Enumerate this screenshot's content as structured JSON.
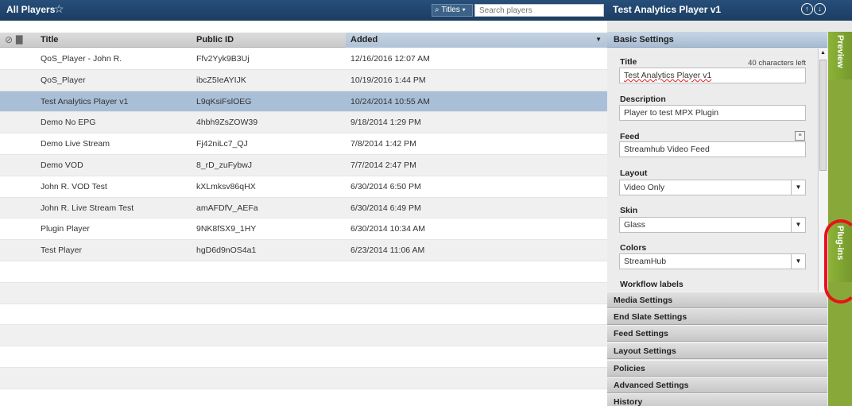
{
  "list": {
    "title": "All Players",
    "search": {
      "filter_label": "Titles",
      "placeholder": "Search players"
    },
    "columns": {
      "title": "Title",
      "public_id": "Public ID",
      "added": "Added"
    },
    "rows": [
      {
        "title": "QoS_Player - John R.",
        "public_id": "Ffv2Yyk9B3Uj",
        "added": "12/16/2016 12:07 AM"
      },
      {
        "title": "QoS_Player",
        "public_id": "ibcZ5IeAYIJK",
        "added": "10/19/2016 1:44 PM"
      },
      {
        "title": "Test Analytics Player v1",
        "public_id": "L9qKsiFslOEG",
        "added": "10/24/2014 10:55 AM"
      },
      {
        "title": "Demo No EPG",
        "public_id": "4hbh9ZsZOW39",
        "added": "9/18/2014 1:29 PM"
      },
      {
        "title": "Demo Live Stream",
        "public_id": "Fj42niLc7_QJ",
        "added": "7/8/2014 1:42 PM"
      },
      {
        "title": "Demo VOD",
        "public_id": "8_rD_zuFybwJ",
        "added": "7/7/2014 2:47 PM"
      },
      {
        "title": "John R. VOD Test",
        "public_id": "kXLmksv86qHX",
        "added": "6/30/2014 6:50 PM"
      },
      {
        "title": "John R. Live Stream Test",
        "public_id": "amAFDfV_AEFa",
        "added": "6/30/2014 6:49 PM"
      },
      {
        "title": "Plugin Player",
        "public_id": "9NK8fSX9_1HY",
        "added": "6/30/2014 10:34 AM"
      },
      {
        "title": "Test Player",
        "public_id": "hgD6d9nOS4a1",
        "added": "6/23/2014 11:06 AM"
      }
    ],
    "selected_index": 2
  },
  "detail": {
    "title": "Test Analytics Player v1",
    "basic_settings": {
      "header": "Basic Settings",
      "title_label": "Title",
      "chars_left": "40 characters left",
      "title_value": "Test Analytics Player v1",
      "description_label": "Description",
      "description_value": "Player to test MPX Plugin",
      "feed_label": "Feed",
      "feed_value": "Streamhub Video Feed",
      "layout_label": "Layout",
      "layout_value": "Video Only",
      "skin_label": "Skin",
      "skin_value": "Glass",
      "colors_label": "Colors",
      "colors_value": "StreamHub",
      "workflow_label": "Workflow labels"
    },
    "sections": [
      "Media Settings",
      "End Slate Settings",
      "Feed Settings",
      "Layout Settings",
      "Policies",
      "Advanced Settings",
      "History"
    ],
    "side_tabs": {
      "preview": "Preview",
      "plugins": "Plug-ins"
    }
  },
  "colors": {
    "header_blue": "#1b3d62",
    "selected_row": "#a9bfd8",
    "tab_green": "#88a93a",
    "annotation_red": "#e8121b"
  }
}
